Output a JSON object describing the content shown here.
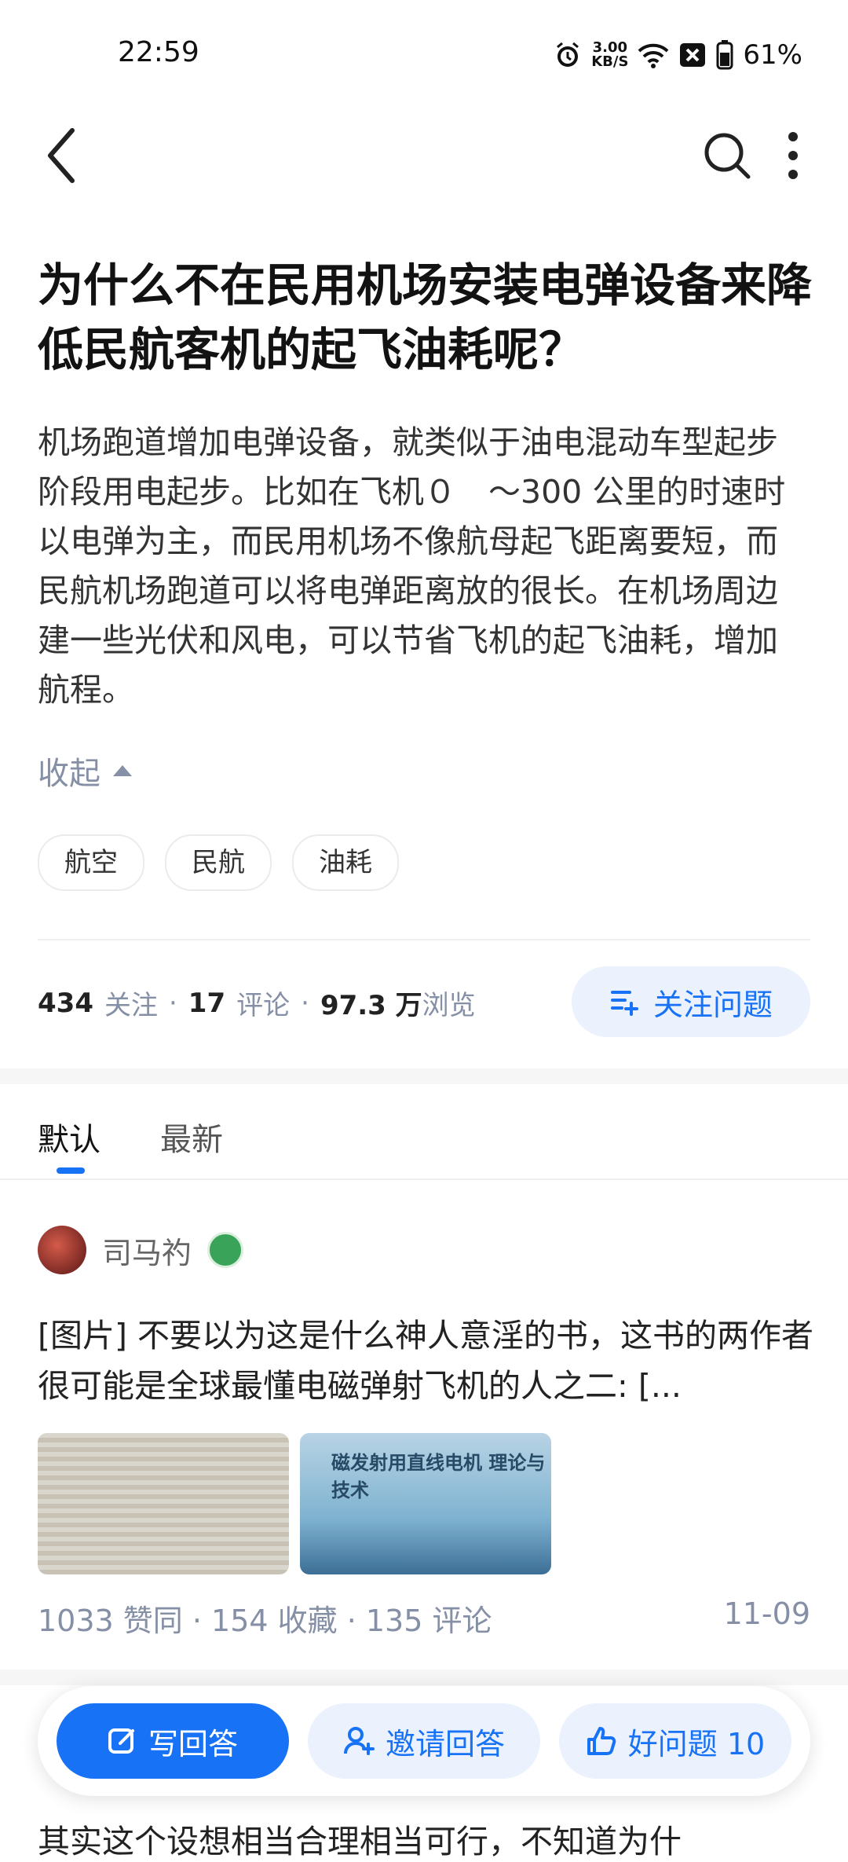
{
  "status_bar": {
    "time": "22:59",
    "speed_value": "3.00",
    "speed_unit": "KB/S",
    "battery": "61%"
  },
  "question": {
    "title": "为什么不在民用机场安装电弹设备来降低民航客机的起飞油耗呢？",
    "description": "机场跑道增加电弹设备，就类似于油电混动车型起步阶段用电起步。比如在飞机０　～300 公里的时速时以电弹为主，而民用机场不像航母起飞距离要短，而民航机场跑道可以将电弹距离放的很长。在机场周边建一些光伏和风电，可以节省飞机的起飞油耗，增加航程。",
    "collapse_label": "收起",
    "tags": [
      "航空",
      "民航",
      "油耗"
    ]
  },
  "stats": {
    "follow_count": "434",
    "follow_label": "关注",
    "comment_count": "17",
    "comment_label": "评论",
    "view_count": "97.3 万",
    "view_label": "浏览",
    "follow_button": "关注问题"
  },
  "tabs": {
    "default": "默认",
    "latest": "最新"
  },
  "answer": {
    "author": "司马礿",
    "excerpt": "[图片] 不要以为这是什么神人意淫的书，这书的两作者很可能是全球最懂电磁弹射飞机的人之二: [...",
    "image2_text": "磁发射用直线电机 理论与技术",
    "meta": "1033 赞同 · 154 收藏 · 135 评论",
    "date": "11-09"
  },
  "next_answer_excerpt": "其实这个设想相当合理相当可行，不知道为什",
  "action_bar": {
    "write": "写回答",
    "invite": "邀请回答",
    "good_question": "好问题 10"
  },
  "colors": {
    "accent": "#1772f6",
    "accent_light": "#ebf2fd",
    "muted": "#8590a6"
  }
}
